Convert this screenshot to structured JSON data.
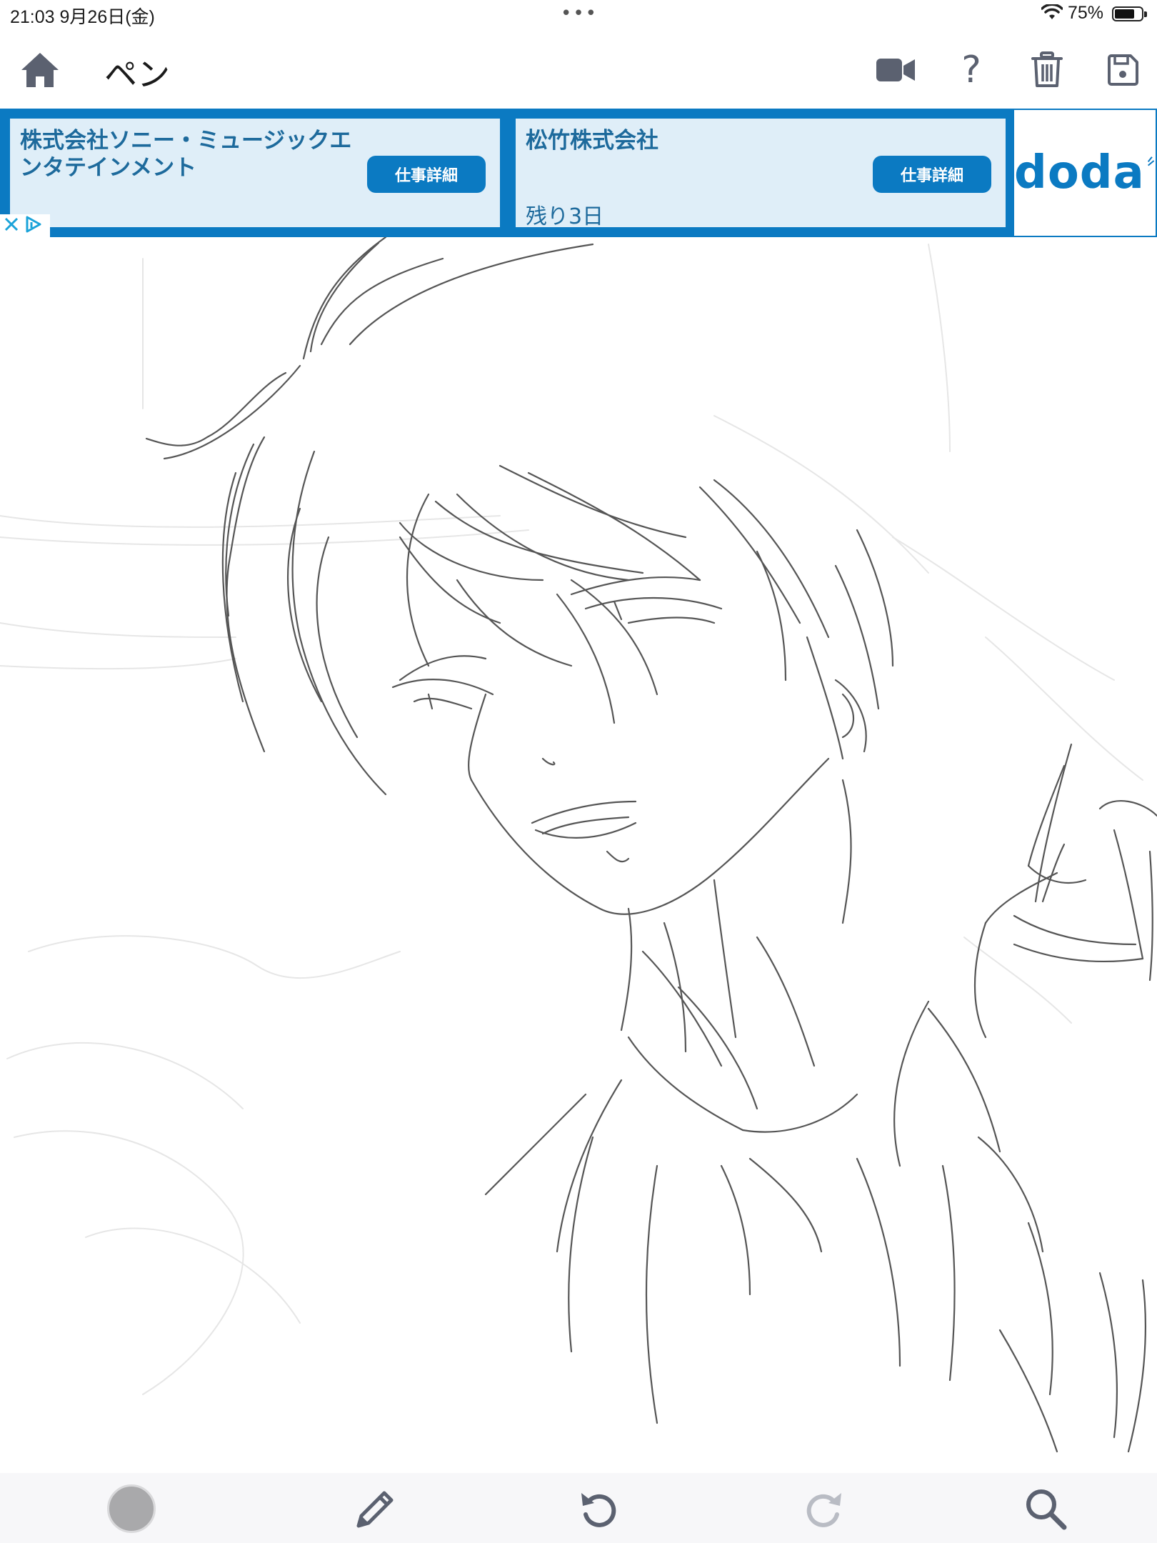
{
  "status_bar": {
    "time_date": "21:03   9月26日(金)",
    "multitask_dots": "•••",
    "battery_percent": "75%",
    "battery_level": 0.75
  },
  "toolbar": {
    "title": "ペン",
    "icons": [
      "home-icon",
      "video-camera-icon",
      "help-icon",
      "trash-icon",
      "save-icon"
    ],
    "help_glyph": "?"
  },
  "ad": {
    "cards": [
      {
        "name": "株式会社ソニー・ミュージックエンタテインメント",
        "sub": "",
        "button": "仕事詳細"
      },
      {
        "name": "松竹株式会社",
        "sub": "残り3日",
        "button": "仕事詳細"
      }
    ],
    "logo": "doda",
    "accent": "#0b7ac2",
    "card_bg": "#dfeef8"
  },
  "bottom_bar": {
    "brush_color": "#a9a9ab",
    "icons": [
      "color-swatch",
      "pencil-icon",
      "undo-icon",
      "redo-icon",
      "zoom-icon"
    ]
  }
}
